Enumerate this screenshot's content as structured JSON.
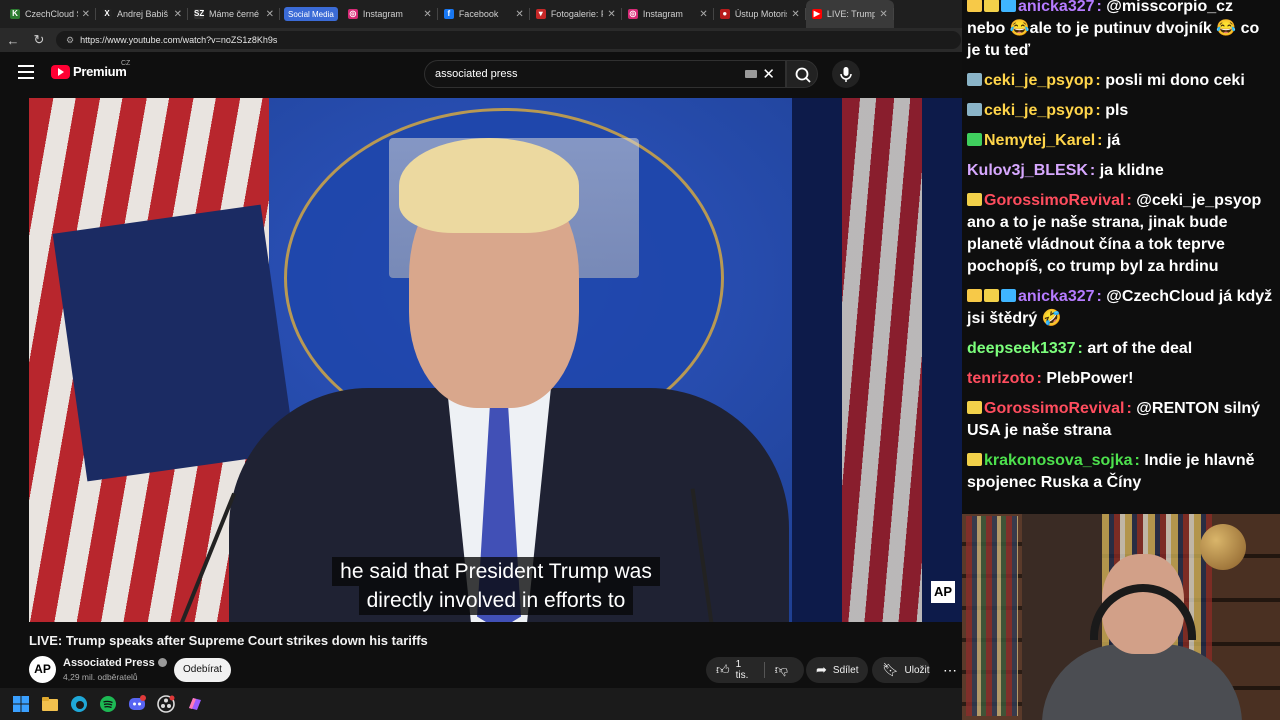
{
  "browser": {
    "tabs": [
      {
        "label": "CzechCloud Stre",
        "icon_color": "#2e7d32",
        "icon_glyph": "K"
      },
      {
        "label": "Andrej Babiš na",
        "icon_color": "#222222",
        "icon_glyph": "X"
      },
      {
        "label": "Máme černé na",
        "icon_color": "#333333",
        "icon_glyph": "SZ"
      },
      {
        "label": "Instagram",
        "icon_color": "#d62976",
        "icon_glyph": "◎"
      },
      {
        "label": "Facebook",
        "icon_color": "#1877f2",
        "icon_glyph": "f"
      },
      {
        "label": "Fotogalerie: Pre",
        "icon_color": "#c62828",
        "icon_glyph": "▾"
      },
      {
        "label": "Instagram",
        "icon_color": "#d62976",
        "icon_glyph": "◎"
      },
      {
        "label": "Ústup Motoristů",
        "icon_color": "#b71c1c",
        "icon_glyph": "●"
      },
      {
        "label": "LIVE: Trump",
        "icon_color": "#ff0000",
        "icon_glyph": "▶"
      }
    ],
    "group_label": "Social Media",
    "url": "https://www.youtube.com/watch?v=noZS1z8Kh9s"
  },
  "youtube": {
    "logo_text": "Premium",
    "logo_region": "CZ",
    "search_value": "associated press",
    "video": {
      "subtitle_line1": "he said that President Trump was",
      "subtitle_line2": "directly involved in efforts to",
      "watermark": "AP"
    },
    "title": "LIVE: Trump speaks after Supreme Court strikes down his tariffs",
    "channel": {
      "avatar_text": "AP",
      "name": "Associated Press",
      "subscribers": "4,29 mil. odběratelů"
    },
    "subscribe_label": "Odebírat",
    "like_count": "1 tis.",
    "share_label": "Sdílet",
    "save_label": "Uložit"
  },
  "chat": {
    "messages": [
      {
        "badges": [
          "crown",
          "clap",
          "cube"
        ],
        "user": "anicka327",
        "color": "#b57bff",
        "text": "@misscorpio_cz nebo 😂ale to je putinuv dvojník 😂 co je tu teď"
      },
      {
        "badges": [
          "rocket"
        ],
        "user": "ceki_je_psyop",
        "color": "#ffd54a",
        "text": "posli mi dono ceki"
      },
      {
        "badges": [
          "rocket"
        ],
        "user": "ceki_je_psyop",
        "color": "#ffd54a",
        "text": "pls"
      },
      {
        "badges": [
          "gem"
        ],
        "user": "Nemytej_Karel",
        "color": "#ffd54a",
        "text": "já"
      },
      {
        "badges": [],
        "user": "Kulov3j_BLESK",
        "color": "#d7a8ff",
        "text": "ja klidne"
      },
      {
        "badges": [
          "clap"
        ],
        "user": "GorossimoRevival",
        "color": "#ff4d5e",
        "text": "@ceki_je_psyop ano a to je naše strana, jinak bude planetě vládnout čína a tok teprve pochopíš, co trump byl za hrdinu"
      },
      {
        "badges": [
          "crown",
          "clap",
          "cube"
        ],
        "user": "anicka327",
        "color": "#b57bff",
        "text": "@CzechCloud já když jsi štědrý 🤣"
      },
      {
        "badges": [],
        "user": "deepseek1337",
        "color": "#7cff7c",
        "text": "art of the deal"
      },
      {
        "badges": [],
        "user": "tenrizoto",
        "color": "#ff4d5e",
        "text": "PlebPower!"
      },
      {
        "badges": [
          "clap"
        ],
        "user": "GorossimoRevival",
        "color": "#ff4d5e",
        "text": "@RENTON silný USA je naše strana"
      },
      {
        "badges": [
          "clap"
        ],
        "user": "krakonosova_sojka",
        "color": "#4de04d",
        "text": "Indie je hlavně spojenec Ruska a Číny"
      }
    ]
  }
}
